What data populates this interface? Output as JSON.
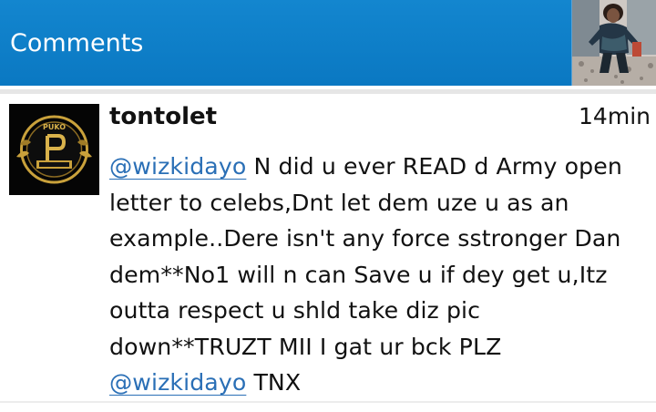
{
  "header": {
    "title": "Comments",
    "background": "#0b7cc5"
  },
  "comment": {
    "username": "tontolet",
    "time": "14min",
    "avatar_logo_text": "PUKO P ENTERTAINMENT",
    "lines": [
      {
        "mention": "@wizkidayo",
        "text": " N did u ever READ d Army open"
      },
      {
        "text": "letter to celebs,Dnt let dem uze u as an"
      },
      {
        "text": "example..Dere isn't any force sstronger Dan"
      },
      {
        "text": "dem**No1 will n can Save u if dey get u,Itz"
      },
      {
        "text": "outta respect u shld take diz pic"
      },
      {
        "text": "down**TRUZT MII I gat ur bck PLZ"
      },
      {
        "mention": "@wizkidayo",
        "text": " TNX"
      }
    ],
    "mention_color": "#2a6fb6"
  }
}
